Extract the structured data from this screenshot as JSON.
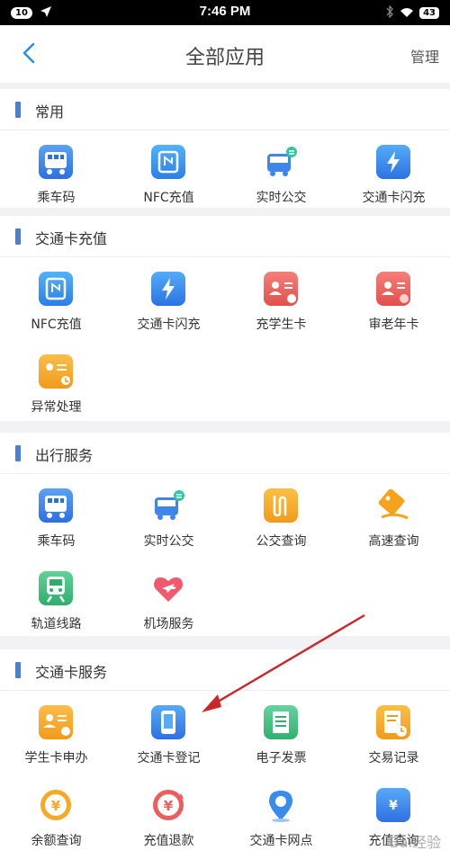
{
  "status": {
    "badge": "10",
    "time": "7:46 PM",
    "battery": "43"
  },
  "nav": {
    "title": "全部应用",
    "manage": "管理"
  },
  "sections": [
    {
      "title": "常用",
      "items": [
        {
          "label": "乘车码",
          "icon": "bus-qr-icon"
        },
        {
          "label": "NFC充值",
          "icon": "nfc-icon"
        },
        {
          "label": "实时公交",
          "icon": "realtime-bus-icon"
        },
        {
          "label": "交通卡闪充",
          "icon": "flash-charge-icon"
        }
      ]
    },
    {
      "title": "交通卡充值",
      "items": [
        {
          "label": "NFC充值",
          "icon": "nfc-icon"
        },
        {
          "label": "交通卡闪充",
          "icon": "flash-charge-icon"
        },
        {
          "label": "充学生卡",
          "icon": "student-card-icon"
        },
        {
          "label": "审老年卡",
          "icon": "senior-card-icon"
        },
        {
          "label": "异常处理",
          "icon": "exception-icon"
        }
      ]
    },
    {
      "title": "出行服务",
      "items": [
        {
          "label": "乘车码",
          "icon": "bus-qr-icon"
        },
        {
          "label": "实时公交",
          "icon": "realtime-bus-icon"
        },
        {
          "label": "公交查询",
          "icon": "bus-query-icon"
        },
        {
          "label": "高速查询",
          "icon": "highway-query-icon"
        },
        {
          "label": "轨道线路",
          "icon": "metro-icon"
        },
        {
          "label": "机场服务",
          "icon": "airport-icon"
        }
      ]
    },
    {
      "title": "交通卡服务",
      "items": [
        {
          "label": "学生卡申办",
          "icon": "student-apply-icon"
        },
        {
          "label": "交通卡登记",
          "icon": "card-register-icon"
        },
        {
          "label": "电子发票",
          "icon": "invoice-icon"
        },
        {
          "label": "交易记录",
          "icon": "transaction-icon"
        },
        {
          "label": "余额查询",
          "icon": "balance-icon"
        },
        {
          "label": "充值退款",
          "icon": "refund-icon"
        },
        {
          "label": "交通卡网点",
          "icon": "location-icon"
        },
        {
          "label": "充值查询",
          "icon": "recharge-query-icon"
        }
      ]
    }
  ],
  "watermark": "Bai经验"
}
